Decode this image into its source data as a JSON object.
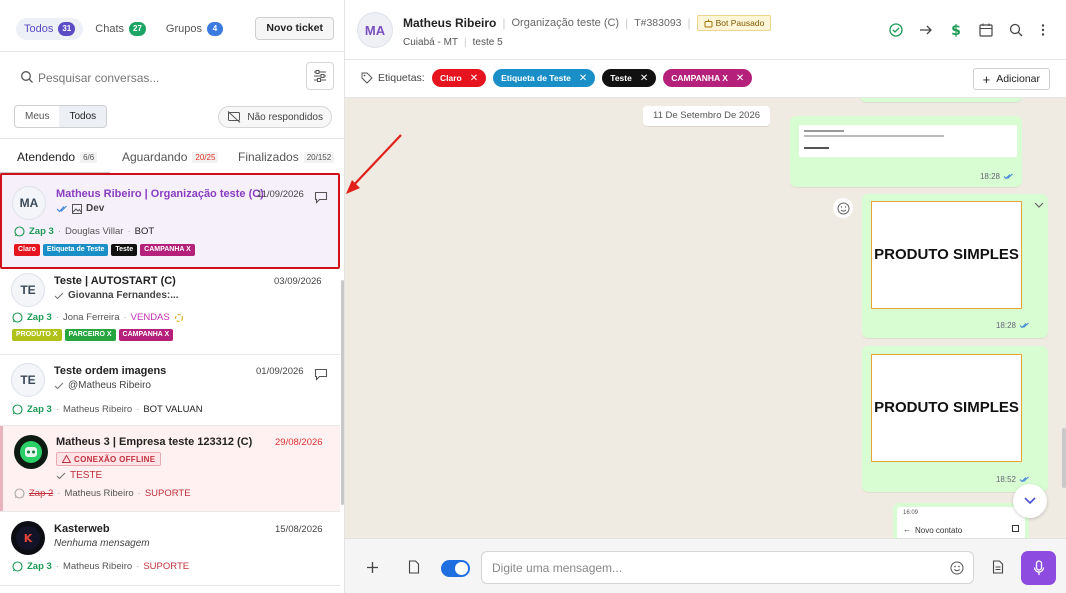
{
  "left": {
    "top_tabs": [
      {
        "label": "Todos",
        "count": "31",
        "color": "#5b4bc4"
      },
      {
        "label": "Chats",
        "count": "27",
        "color": "#1ba463"
      },
      {
        "label": "Grupos",
        "count": "4",
        "color": "#3b7be0"
      }
    ],
    "new_ticket_label": "Novo ticket",
    "search_placeholder": "Pesquisar conversas...",
    "scope": {
      "meus": "Meus",
      "todos": "Todos"
    },
    "nao_respondidos": "Não respondidos",
    "status_tabs": [
      {
        "label": "Atendendo",
        "count": "6/6"
      },
      {
        "label": "Aguardando",
        "count": "20/25"
      },
      {
        "label": "Finalizados",
        "count": "20/152"
      }
    ],
    "conversations": [
      {
        "avatar": "MA",
        "name": "Matheus Ribeiro | Organização teste (C)",
        "date": "11/09/2026",
        "sub": "Dev",
        "channel": "Zap 3",
        "agent": "Douglas Villar",
        "queue": "BOT",
        "tags": [
          {
            "label": "Claro",
            "color": "#e5141f"
          },
          {
            "label": "Etiqueta de Teste",
            "color": "#1a8fc7"
          },
          {
            "label": "Teste",
            "color": "#111111"
          },
          {
            "label": "CAMPANHA X",
            "color": "#b5207a"
          }
        ]
      },
      {
        "avatar": "TE",
        "name": "Teste | AUTOSTART (C)",
        "date": "03/09/2026",
        "sub": "Giovanna Fernandes:...",
        "channel": "Zap 3",
        "agent": "Jona Ferreira",
        "queue": "VENDAS",
        "tags": [
          {
            "label": "PRODUTO X",
            "color": "#b0c21a"
          },
          {
            "label": "PARCEIRO X",
            "color": "#27a640"
          },
          {
            "label": "CAMPANHA X",
            "color": "#b5207a"
          }
        ]
      },
      {
        "avatar": "TE",
        "name": "Teste ordem imagens",
        "date": "01/09/2026",
        "sub": "@Matheus Ribeiro",
        "channel": "Zap 3",
        "agent": "Matheus Ribeiro",
        "queue": "BOT VALUAN"
      },
      {
        "name": "Matheus 3 | Empresa teste 123312 (C)",
        "date": "29/08/2026",
        "badge": "CONEXÃO OFFLINE",
        "sub": "TESTE",
        "channel": "Zap 2",
        "agent": "Matheus Ribeiro",
        "queue": "SUPORTE"
      },
      {
        "name": "Kasterweb",
        "date": "15/08/2026",
        "sub": "Nenhuma mensagem",
        "channel": "Zap 3",
        "agent": "Matheus Ribeiro",
        "queue": "SUPORTE"
      }
    ]
  },
  "header": {
    "avatar": "MA",
    "name": "Matheus Ribeiro",
    "org": "Organização teste (C)",
    "ticket": "T#383093",
    "bot_status": "Bot Pausado",
    "city": "Cuiabá - MT",
    "queue": "teste 5"
  },
  "tagbar": {
    "label": "Etiquetas:",
    "chips": [
      {
        "label": "Claro",
        "color": "#e5141f"
      },
      {
        "label": "Etiqueta de Teste",
        "color": "#1a8fc7"
      },
      {
        "label": "Teste",
        "color": "#111111"
      },
      {
        "label": "CAMPANHA X",
        "color": "#b5207a"
      }
    ],
    "add_label": "Adicionar"
  },
  "chat": {
    "date_divider": "11 De Setembro De 2026",
    "messages": [
      {
        "time": "18:28"
      },
      {
        "card": "PRODUTO SIMPLES",
        "time": "18:28"
      },
      {
        "card": "PRODUTO SIMPLES",
        "time": "18:52"
      }
    ],
    "preview_time": "16:09",
    "preview_text": "Novo contato"
  },
  "composer": {
    "placeholder": "Digite uma mensagem..."
  }
}
